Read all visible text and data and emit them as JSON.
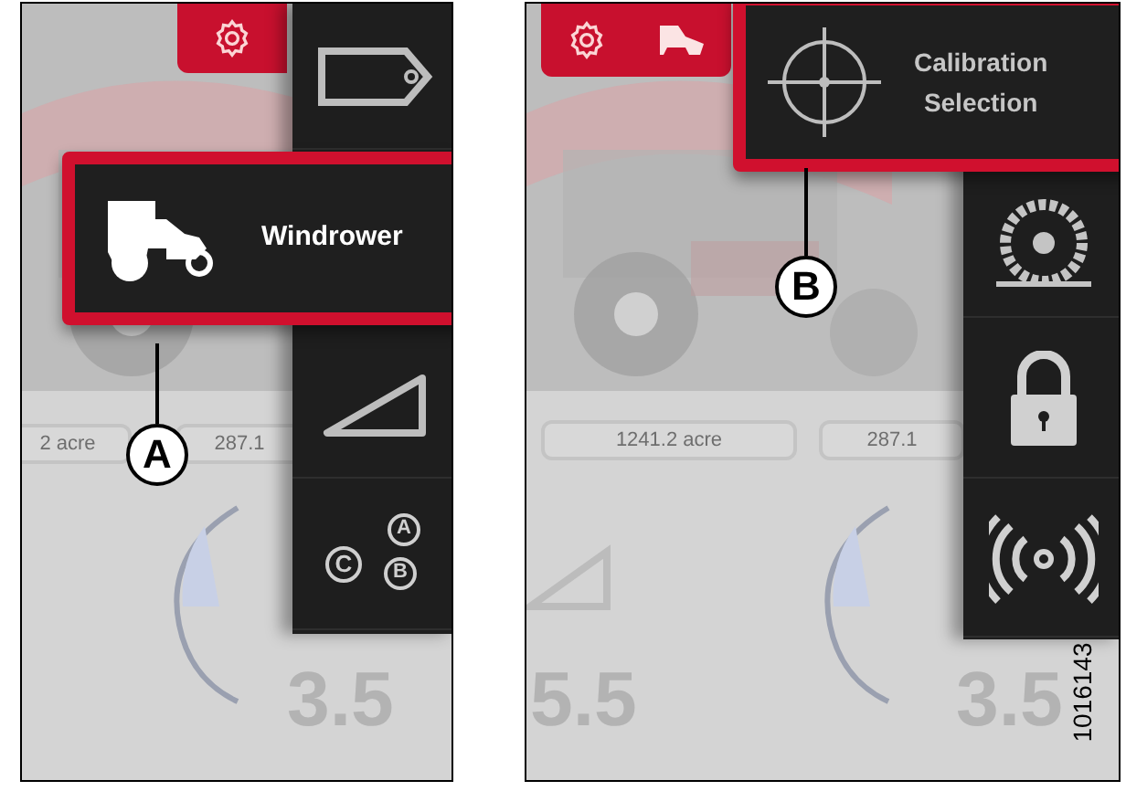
{
  "left_screen": {
    "highlighted_item": {
      "label": "Windrower"
    },
    "readouts": [
      "2 acre",
      "287.1"
    ],
    "menu_letters": [
      "C",
      "A",
      "B"
    ],
    "gauge_values": [
      "3.5"
    ]
  },
  "right_screen": {
    "highlighted_item": {
      "label": "Calibration\nSelection"
    },
    "readouts": [
      "1241.2 acre",
      "287.1"
    ],
    "gauge_values": [
      "5.5",
      "3.5"
    ]
  },
  "callouts": [
    "A",
    "B"
  ],
  "figure_number": "1016143"
}
